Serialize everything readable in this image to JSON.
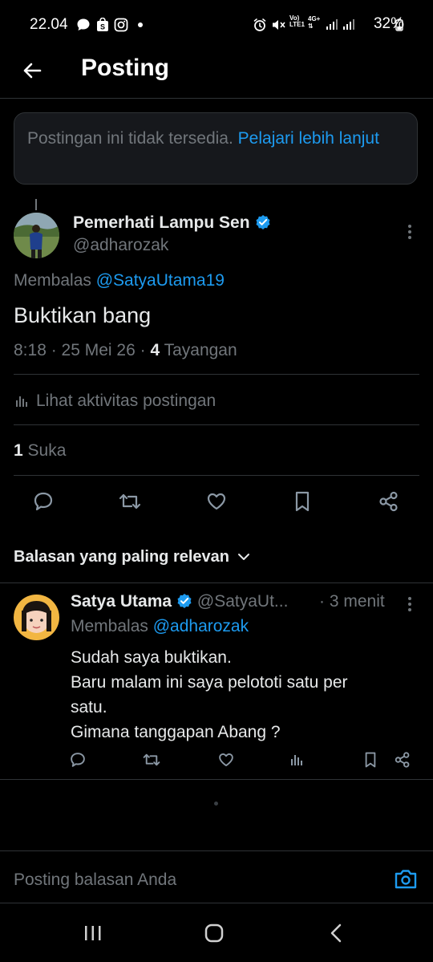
{
  "status": {
    "time": "22.04",
    "battery": "32%"
  },
  "header": {
    "title": "Posting"
  },
  "notice": {
    "text": "Postingan ini tidak tersedia.",
    "link": "Pelajari lebih lanjut"
  },
  "post": {
    "author_name": "Pemerhati Lampu Sen",
    "author_handle": "@adharozak",
    "replying_prefix": "Membalas",
    "replying_to": "@SatyaUtama19",
    "body": "Buktikan bang",
    "timestamp": "8:18 · 25 Mei 26 ·",
    "views_count": "4",
    "views_label": "Tayangan",
    "activity_label": "Lihat aktivitas postingan",
    "likes_count": "1",
    "likes_label": "Suka"
  },
  "replies_sort": {
    "label": "Balasan yang paling relevan"
  },
  "reply": {
    "author_name": "Satya Utama",
    "author_handle": "@SatyaUt...",
    "time": "· 3 menit",
    "replying_prefix": "Membalas",
    "replying_to": "@adharozak",
    "lines": [
      "Sudah saya buktikan.",
      "Baru malam ini saya pelototi satu per",
      "satu.",
      "Gimana tanggapan Abang ?"
    ]
  },
  "compose": {
    "placeholder": "Posting balasan Anda"
  },
  "colors": {
    "accent": "#1d9bf0",
    "background": "#000000",
    "border": "#2f3336",
    "muted": "#71767b"
  }
}
